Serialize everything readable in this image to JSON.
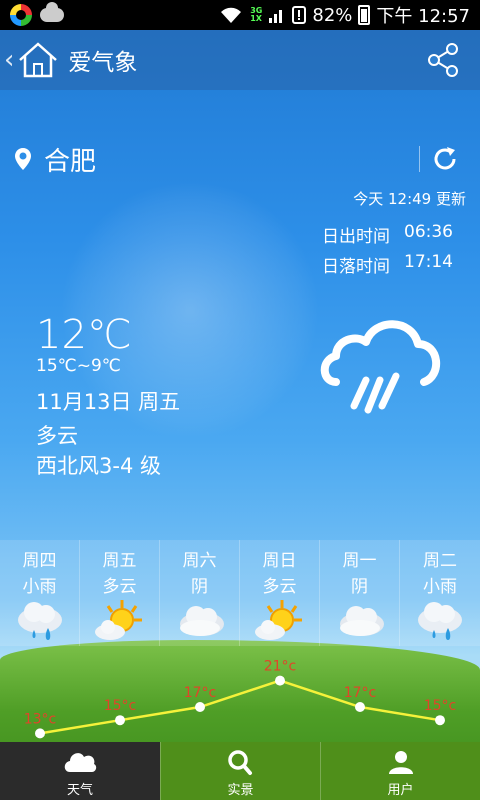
{
  "status_bar": {
    "battery": "82%",
    "time": "下午 12:57",
    "network_top": "3G",
    "network_bottom": "1X"
  },
  "app": {
    "title": "爱气象"
  },
  "location": {
    "city": "合肥"
  },
  "update_time": "今天 12:49 更新",
  "sunrise": {
    "label": "日出时间",
    "value": "06:36"
  },
  "sunset": {
    "label": "日落时间",
    "value": "17:14"
  },
  "current": {
    "temp": "12℃",
    "range": "15℃~9℃",
    "date": "11月13日 周五",
    "condition": "多云",
    "wind": "西北风3-4 级",
    "icon": "cloud-rain-icon"
  },
  "forecast": [
    {
      "day": "周四",
      "cond": "小雨",
      "icon": "rain-icon",
      "temp": "13°c"
    },
    {
      "day": "周五",
      "cond": "多云",
      "icon": "sun-cloud-icon",
      "temp": "15°c"
    },
    {
      "day": "周六",
      "cond": "阴",
      "icon": "cloudy-icon",
      "temp": "17°c"
    },
    {
      "day": "周日",
      "cond": "多云",
      "icon": "sun-cloud-icon",
      "temp": "21°c"
    },
    {
      "day": "周一",
      "cond": "阴",
      "icon": "cloudy-icon",
      "temp": "17°c"
    },
    {
      "day": "周二",
      "cond": "小雨",
      "icon": "rain-icon",
      "temp": "15°c"
    }
  ],
  "chart_data": {
    "type": "line",
    "categories": [
      "周四",
      "周五",
      "周六",
      "周日",
      "周一",
      "周二"
    ],
    "series": [
      {
        "values": [
          13,
          15,
          17,
          21,
          17,
          15
        ]
      }
    ],
    "labels": [
      "13°c",
      "15°c",
      "17°c",
      "21°c",
      "17°c",
      "15°c"
    ],
    "line_color": "#f5f23a",
    "label_color": "#e0452a"
  },
  "tabs": [
    {
      "label": "天气",
      "icon": "cloud-icon",
      "active": true
    },
    {
      "label": "实景",
      "icon": "search-icon",
      "active": false
    },
    {
      "label": "用户",
      "icon": "user-icon",
      "active": false
    }
  ]
}
